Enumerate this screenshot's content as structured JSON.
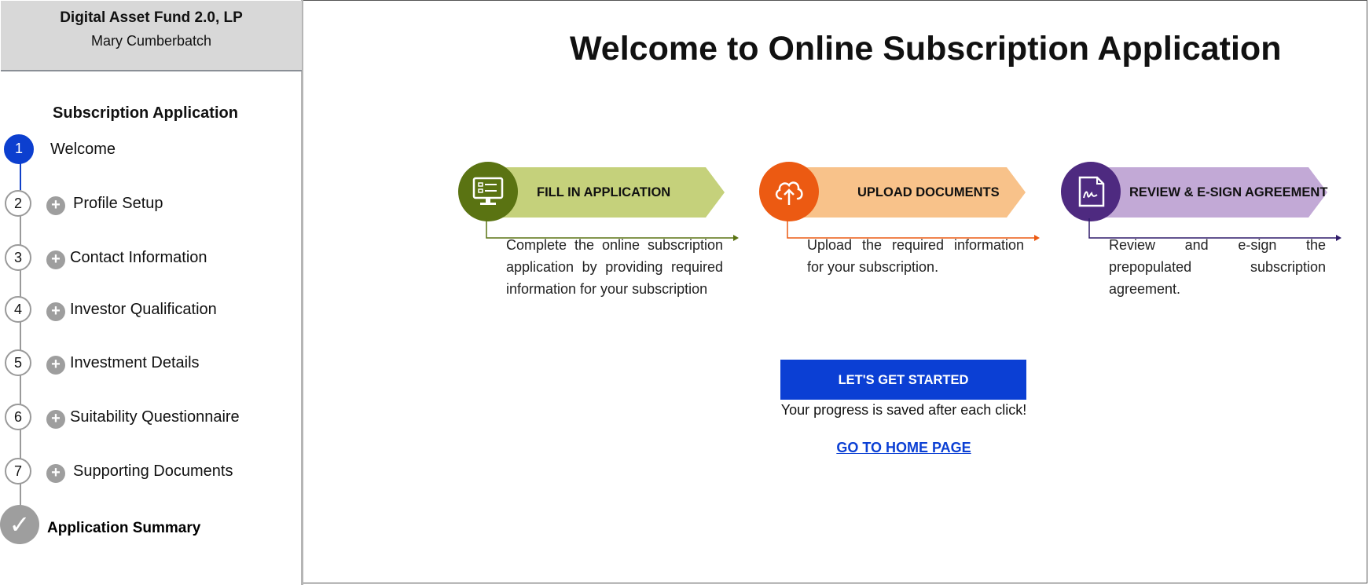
{
  "sidebar": {
    "fund_name": "Digital Asset Fund 2.0, LP",
    "user_name": "Mary Cumberbatch",
    "section_title": "Subscription Application",
    "steps": [
      {
        "number": "1",
        "label": "Welcome",
        "active": true
      },
      {
        "number": "2",
        "label": "Profile Setup"
      },
      {
        "number": "3",
        "label": "Contact Information"
      },
      {
        "number": "4",
        "label": "Investor Qualification"
      },
      {
        "number": "5",
        "label": "Investment Details"
      },
      {
        "number": "6",
        "label": "Suitability Questionnaire"
      },
      {
        "number": "7",
        "label": "Supporting Documents"
      }
    ],
    "summary": {
      "icon": "checkmark-icon",
      "glyph": "✓",
      "label": "Application Summary"
    },
    "expand_glyph": "+"
  },
  "main": {
    "title": "Welcome to Online Subscription Application",
    "cards": [
      {
        "title": "FILL IN APPLICATION",
        "description": "Complete the online subscription application by providing required information for your subscription",
        "icon": "monitor-form-icon",
        "circle_color": "#5a7312",
        "banner_color": "#c5d17b",
        "line_color": "#5a7312"
      },
      {
        "title": "UPLOAD DOCUMENTS",
        "description": "Upload the required information for your subscription.",
        "icon": "cloud-upload-icon",
        "circle_color": "#ec5a12",
        "banner_color": "#f8c28a",
        "line_color": "#ec5a12"
      },
      {
        "title": "REVIEW & E-SIGN AGREEMENT",
        "description": "Review and e-sign the prepopulated subscription agreement.",
        "icon": "signature-document-icon",
        "circle_color": "#4e2a80",
        "banner_color": "#c2a9d6",
        "line_color": "#2f1a6a"
      }
    ],
    "start_button": "LET'S GET STARTED",
    "saved_note": "Your progress is saved after each click!",
    "home_link": "GO TO HOME PAGE"
  },
  "colors": {
    "accent_blue": "#0b3fd4",
    "step_grey": "#9e9e9e",
    "header_grey": "#d8d8d8"
  }
}
